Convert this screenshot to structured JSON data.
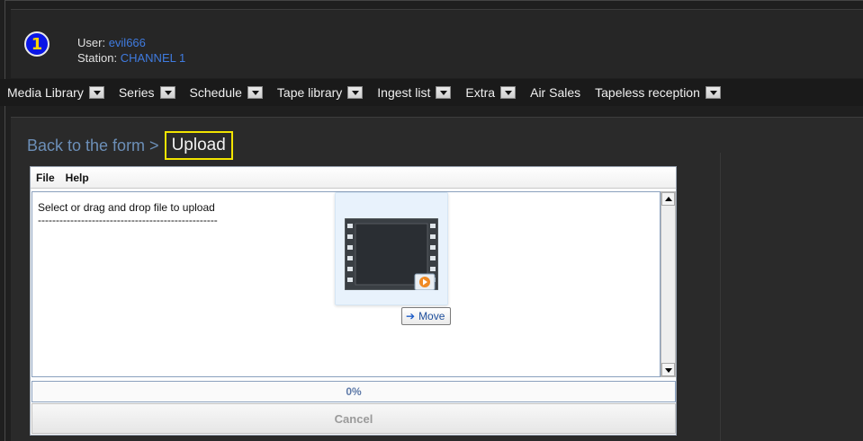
{
  "header": {
    "badge_number": "1",
    "user_label": "User:",
    "user_value": "evil666",
    "station_label": "Station:",
    "station_value": "CHANNEL 1"
  },
  "menu": {
    "items": [
      {
        "label": "Media Library",
        "dropdown": true
      },
      {
        "label": "Series",
        "dropdown": true
      },
      {
        "label": "Schedule",
        "dropdown": true
      },
      {
        "label": "Tape library",
        "dropdown": true
      },
      {
        "label": "Ingest list",
        "dropdown": true
      },
      {
        "label": "Extra",
        "dropdown": true
      },
      {
        "label": "Air Sales",
        "dropdown": false
      },
      {
        "label": "Tapeless reception",
        "dropdown": true
      }
    ]
  },
  "breadcrumb": {
    "back_label": "Back to the form >",
    "current": "Upload"
  },
  "uploader": {
    "menu": [
      "File",
      "Help"
    ],
    "message": "Select or drag and drop file to upload",
    "separator": "--------------------------------------------------",
    "progress": "0%",
    "cancel_label": "Cancel"
  },
  "drag": {
    "tooltip": "Move",
    "icon": "video-file-icon"
  },
  "colors": {
    "accent_blue": "#3f7be0",
    "highlight_yellow": "#f2e400",
    "badge_blue": "#0a16e6"
  }
}
